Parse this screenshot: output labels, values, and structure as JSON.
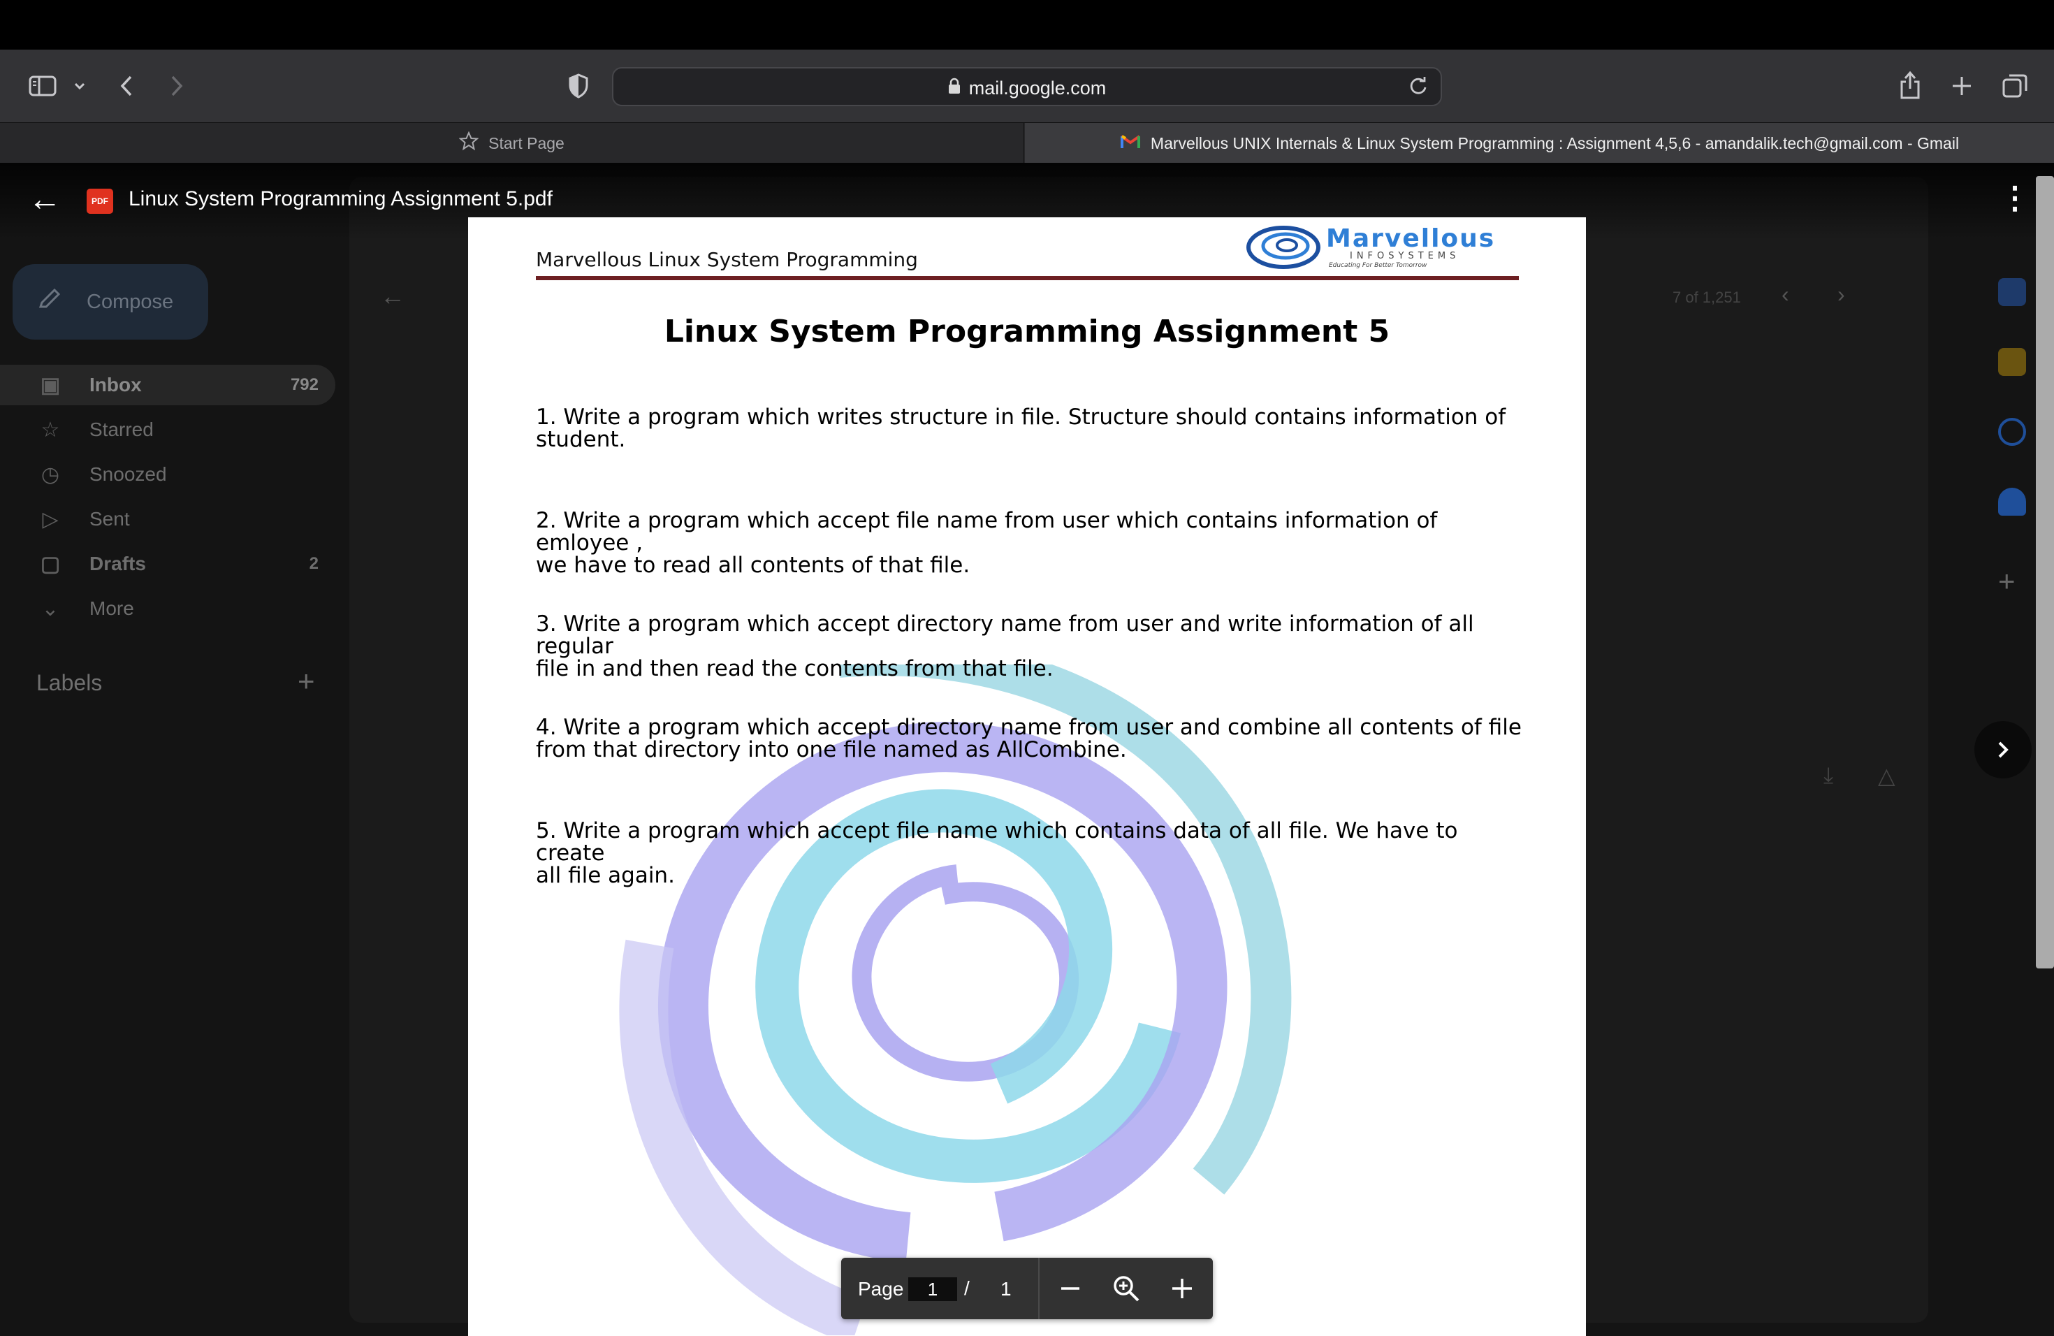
{
  "browser": {
    "url": "mail.google.com",
    "tabs": [
      {
        "label": "Start Page"
      },
      {
        "label": "Marvellous UNIX Internals & Linux System Programming : Assignment 4,5,6 - amandalik.tech@gmail.com - Gmail"
      }
    ]
  },
  "gmail": {
    "compose_label": "Compose",
    "nav": [
      {
        "label": "Inbox",
        "count": "792"
      },
      {
        "label": "Starred",
        "count": ""
      },
      {
        "label": "Snoozed",
        "count": ""
      },
      {
        "label": "Sent",
        "count": ""
      },
      {
        "label": "Drafts",
        "count": "2"
      },
      {
        "label": "More",
        "count": ""
      }
    ],
    "labels_heading": "Labels",
    "pagination": "7 of 1,251"
  },
  "viewer": {
    "badge": "PDF",
    "file_name": "Linux System Programming Assignment 5.pdf"
  },
  "document": {
    "header": "Marvellous Linux System Programming",
    "logo_name": "Marvellous",
    "logo_sub": "INFOSYSTEMS",
    "logo_tagline": "Educating For Better Tomorrow",
    "title": "Linux System Programming Assignment 5",
    "questions": [
      {
        "line1": "1. Write a program which writes structure in file. Structure should contains information of",
        "line2": "student."
      },
      {
        "line1": "2. Write a program which accept file name from user which contains information of emloyee ,",
        "line2": "we have to read all contents of that file."
      },
      {
        "line1": "3. Write a program which accept directory name from user and write information of all regular",
        "line2": "file in and then read the contents from that file."
      },
      {
        "line1": "4. Write a program which accept directory name from user and combine all contents of file",
        "line2": "from that directory into one file named as AllCombine."
      },
      {
        "line1": "5. Write a program which accept file name which contains data of all file. We have to create",
        "line2": "all file again."
      }
    ]
  },
  "pdf_controls": {
    "page_label": "Page",
    "current_page": "1",
    "separator": "/",
    "total_pages": "1"
  },
  "colors": {
    "accent_pdf": "#e0321f",
    "rule": "#6d1f22",
    "logo_blue": "#2f7fd6"
  }
}
